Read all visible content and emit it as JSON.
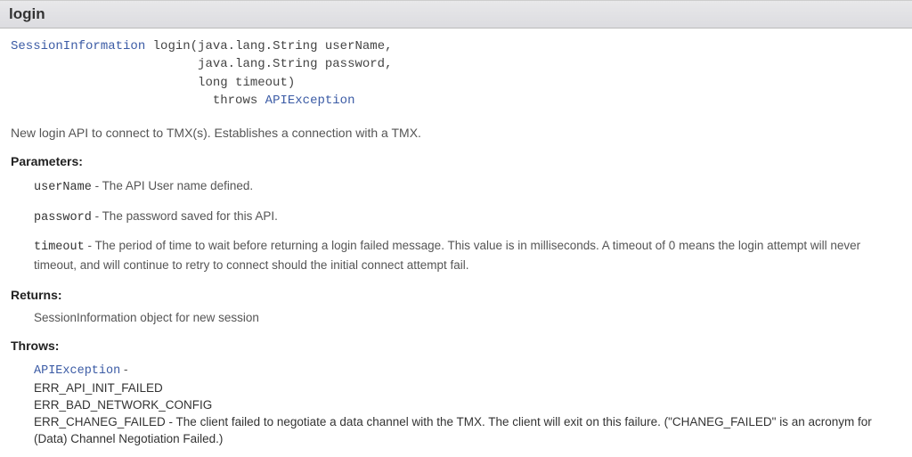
{
  "header": {
    "title": "login"
  },
  "signature": {
    "return_type": "SessionInformation",
    "method_name": "login",
    "param1": "(java.lang.String userName,",
    "param2": "java.lang.String password,",
    "param3": "long timeout)",
    "throws_kw": "throws",
    "throws_type": "APIException"
  },
  "description": "New login API to connect to TMX(s). Establishes a connection with a TMX.",
  "sections": {
    "parameters_heading": "Parameters:",
    "returns_heading": "Returns:",
    "throws_heading": "Throws:"
  },
  "parameters": [
    {
      "name": "userName",
      "desc": " - The API User name defined."
    },
    {
      "name": "password",
      "desc": " - The password saved for this API."
    },
    {
      "name": "timeout",
      "desc": " - The period of time to wait before returning a login failed message. This value is in milliseconds. A timeout of 0 means the login attempt will never timeout, and will continue to retry to connect should the initial connect attempt fail."
    }
  ],
  "returns": "SessionInformation object for new session",
  "throws": {
    "exception": "APIException",
    "dash": " -",
    "code1": "ERR_API_INIT_FAILED",
    "code2": "ERR_BAD_NETWORK_CONFIG",
    "code3_name": "ERR_CHANEG_FAILED",
    "code3_desc": " - The client failed to negotiate a data channel with the TMX. The client will exit on this failure. (\"CHANEG_FAILED\" is an acronym for (Data) Channel Negotiation Failed.)"
  }
}
